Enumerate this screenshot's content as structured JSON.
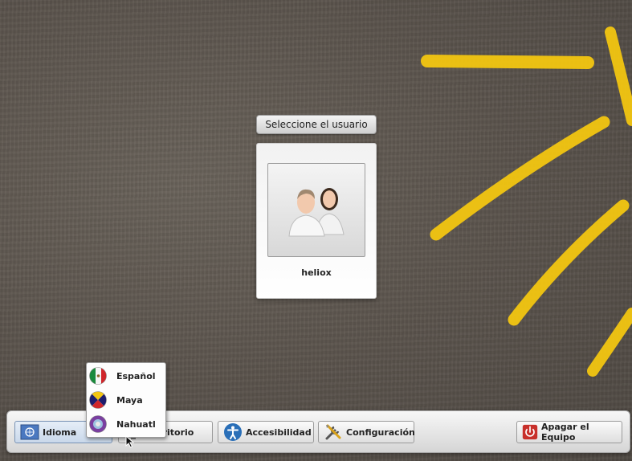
{
  "login": {
    "title": "Seleccione el usuario",
    "users": [
      {
        "name": "heliox",
        "icon": "users-avatar-icon"
      }
    ]
  },
  "taskbar": {
    "idioma_label": "Idioma",
    "escritorio_label": "Escritorio",
    "accesibilidad_label": "Accesibilidad",
    "configuracion_label": "Configuración",
    "apagar_label": "Apagar el Equipo"
  },
  "language_menu": {
    "items": [
      {
        "label": "Español",
        "icon": "mexico-flag-icon"
      },
      {
        "label": "Maya",
        "icon": "maya-flag-icon"
      },
      {
        "label": "Nahuatl",
        "icon": "nahuatl-flag-icon"
      }
    ]
  },
  "colors": {
    "sun_yellow": "#f3c611",
    "background": "#5e5750",
    "power_red": "#c8302b",
    "accessibility_blue": "#2a6fb8"
  }
}
